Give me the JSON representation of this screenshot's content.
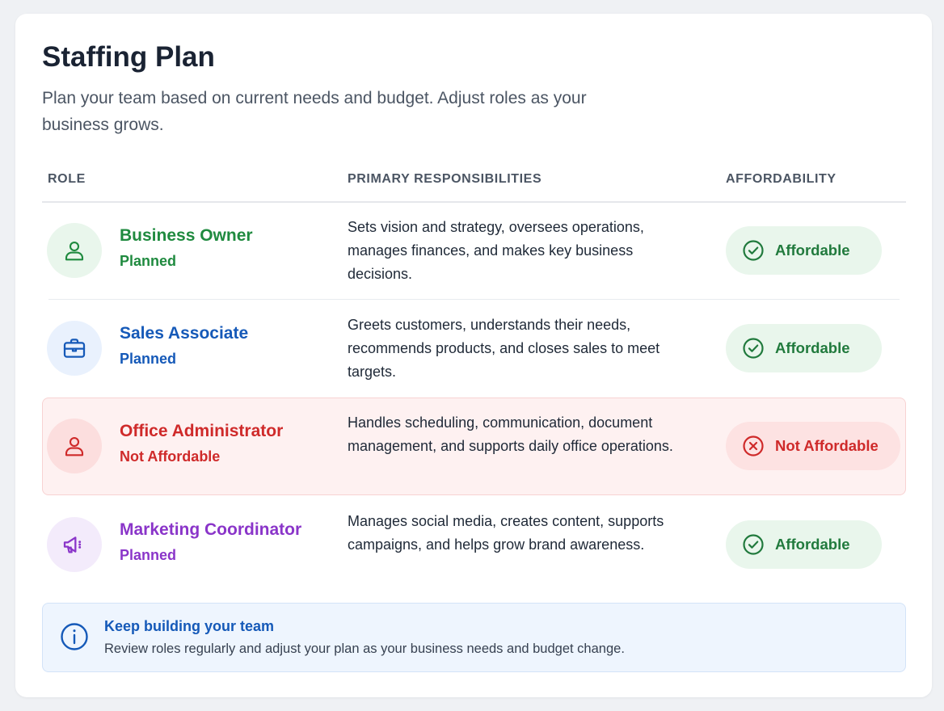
{
  "header": {
    "title": "Staffing Plan",
    "subtitle": "Plan your team based on current needs and budget. Adjust roles as your business grows."
  },
  "table": {
    "columns": [
      "ROLE",
      "PRIMARY RESPONSIBILITIES",
      "AFFORDABILITY"
    ],
    "rows": [
      {
        "role": "Business Owner",
        "status": "Planned",
        "icon": "user-icon",
        "accent": "#1f8a3f",
        "avatar_bg": "#e9f6ec",
        "responsibilities": "Sets vision and strategy, oversees operations, manages finances, and makes key business decisions.",
        "affordability": "Affordable",
        "affordability_icon": "check-circle-icon"
      },
      {
        "role": "Sales Associate",
        "status": "Planned",
        "icon": "briefcase-icon",
        "accent": "#1559b8",
        "avatar_bg": "#e9f1fd",
        "responsibilities": "Greets customers, understands their needs, recommends products, and closes sales to meet targets.",
        "affordability": "Affordable",
        "affordability_icon": "check-circle-icon"
      },
      {
        "role": "Office Administrator",
        "status": "Not Affordable",
        "icon": "user-icon",
        "accent": "#cf2a2a",
        "avatar_bg": "#fcdede",
        "responsibilities": "Handles scheduling, communication, document management, and supports daily office operations.",
        "affordability": "Not Affordable",
        "affordability_icon": "x-circle-icon"
      },
      {
        "role": "Marketing Coordinator",
        "status": "Planned",
        "icon": "megaphone-icon",
        "accent": "#8a35c9",
        "avatar_bg": "#f3ebfb",
        "responsibilities": "Manages social media, creates content, supports campaigns, and helps grow brand awareness.",
        "affordability": "Affordable",
        "affordability_icon": "check-circle-icon"
      }
    ]
  },
  "info": {
    "title": "Keep building your team",
    "text": "Review roles regularly and adjust your plan as your business needs and budget change.",
    "icon": "info-icon"
  },
  "colors": {
    "affordable": "#217a3d",
    "not_affordable": "#cf2a2a",
    "info": "#1559b8"
  }
}
